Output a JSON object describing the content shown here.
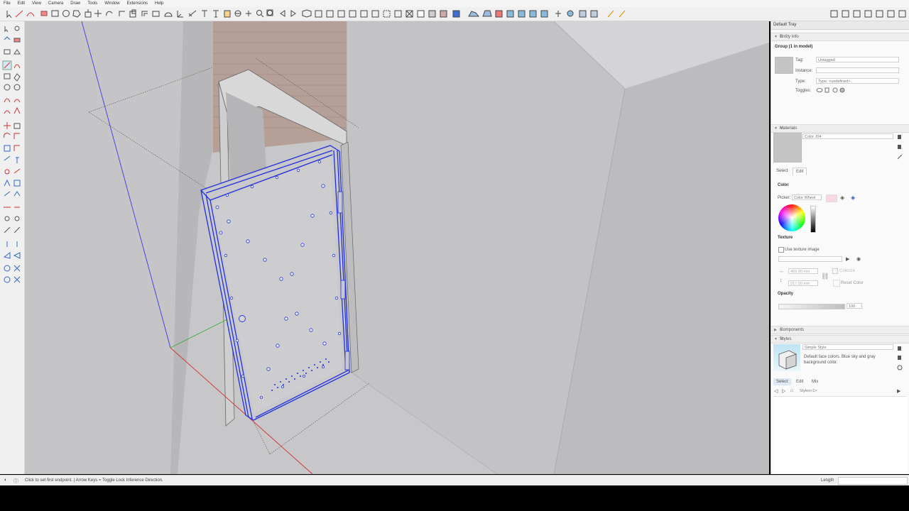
{
  "menu": [
    "File",
    "Edit",
    "View",
    "Camera",
    "Draw",
    "Tools",
    "Window",
    "Extensions",
    "Help"
  ],
  "status": {
    "hint": "Click to set first endpoint. | Arrow Keys = Toggle Lock Inference Direction.",
    "vcb_label": "Length",
    "vcb_value": ""
  },
  "tray": {
    "title": "Default Tray",
    "entity_info": {
      "header": "Entity Info",
      "selection": "Group (1 in model)",
      "tag_label": "Tag:",
      "tag_value": "Untagged",
      "instance_label": "Instance:",
      "instance_value": "",
      "type_label": "Type:",
      "type_value": "Type: <undefined>",
      "toggles_label": "Toggles:"
    },
    "materials": {
      "header": "Materials",
      "name": "Color J04",
      "tabs": [
        "Select",
        "Edit"
      ],
      "active_tab": "Edit",
      "color_heading": "Color",
      "picker_label": "Picker:",
      "picker_value": "Color Wheel",
      "texture_heading": "Texture",
      "use_texture_label": "Use texture image",
      "width_value": "469.90 mm",
      "height_value": "317.50 mm",
      "colorize_label": "Colorize",
      "reset_label": "Reset Color",
      "opacity_heading": "Opacity",
      "opacity_value": "100",
      "swatch_color": "#c4c4c4",
      "tint_color": "#f8d8e4"
    },
    "components": {
      "header": "Components"
    },
    "styles": {
      "header": "Styles",
      "style_name": "Simple Style",
      "description": "Default face colors. Blue sky and gray background color.",
      "tabs": [
        "Select",
        "Edit",
        "Mix"
      ],
      "active_tab": "Select",
      "collection": "Styles<1>"
    }
  },
  "colors": {
    "selection": "#1f2fe0",
    "viewport_bg": "#c7c7c9",
    "axis_red": "#d03030",
    "axis_green": "#35b035",
    "axis_blue": "#3a3ae8"
  }
}
